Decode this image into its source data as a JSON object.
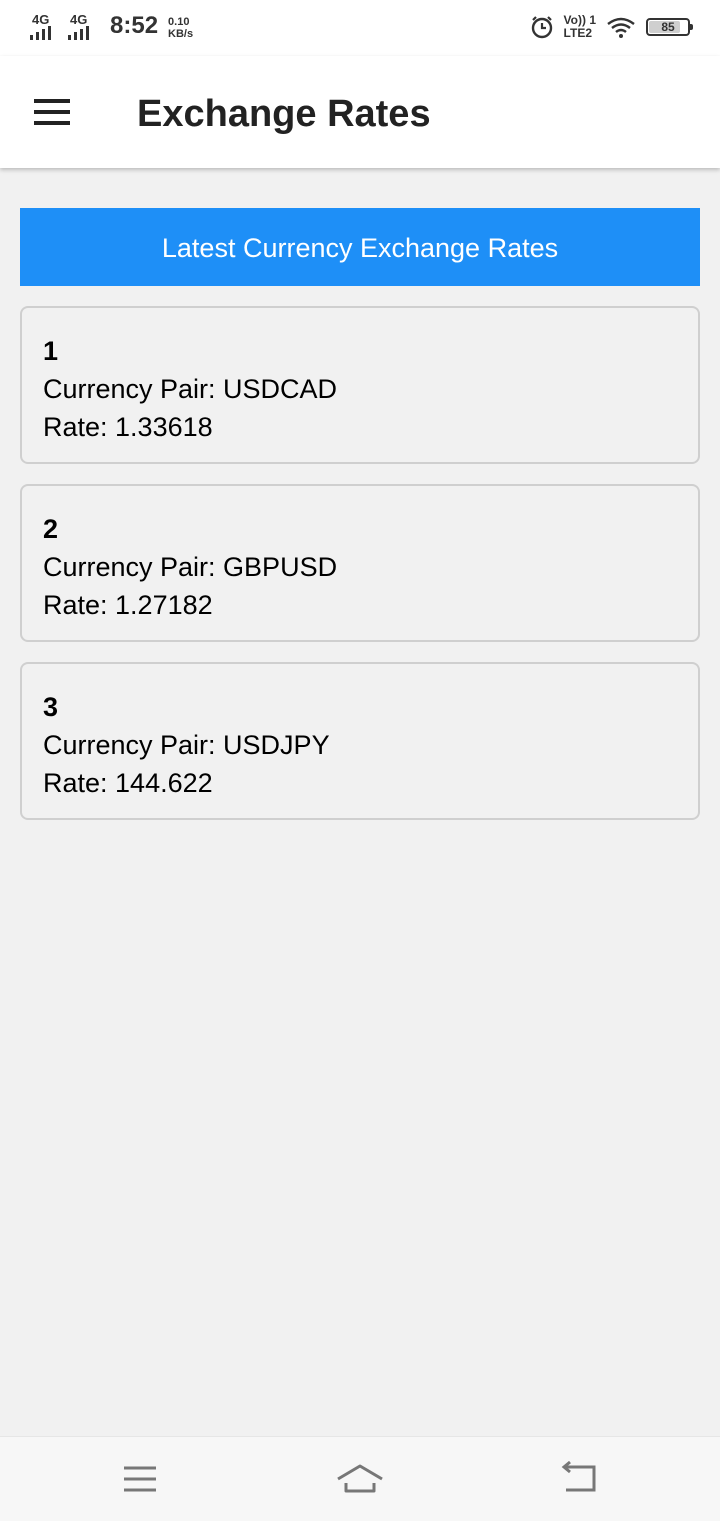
{
  "status_bar": {
    "network1": "4G",
    "network2": "4G",
    "time": "8:52",
    "speed_value": "0.10",
    "speed_unit": "KB/s",
    "volte_top": "Vo)) 1",
    "volte_bottom": "LTE2",
    "battery": "85",
    "battery_level": 0.85
  },
  "app_bar": {
    "title": "Exchange Rates",
    "menu_icon": "hamburger-icon"
  },
  "banner": {
    "text": "Latest Currency Exchange Rates",
    "color": "#1e8ff7"
  },
  "rates": [
    {
      "index": "1",
      "pair": "Currency Pair: USDCAD",
      "rate": "Rate: 1.33618"
    },
    {
      "index": "2",
      "pair": "Currency Pair: GBPUSD",
      "rate": "Rate: 1.27182"
    },
    {
      "index": "3",
      "pair": "Currency Pair: USDJPY",
      "rate": "Rate: 144.622"
    }
  ],
  "nav_bar": {
    "recents_icon": "recents-menu-icon",
    "home_icon": "home-icon",
    "back_icon": "back-icon"
  }
}
